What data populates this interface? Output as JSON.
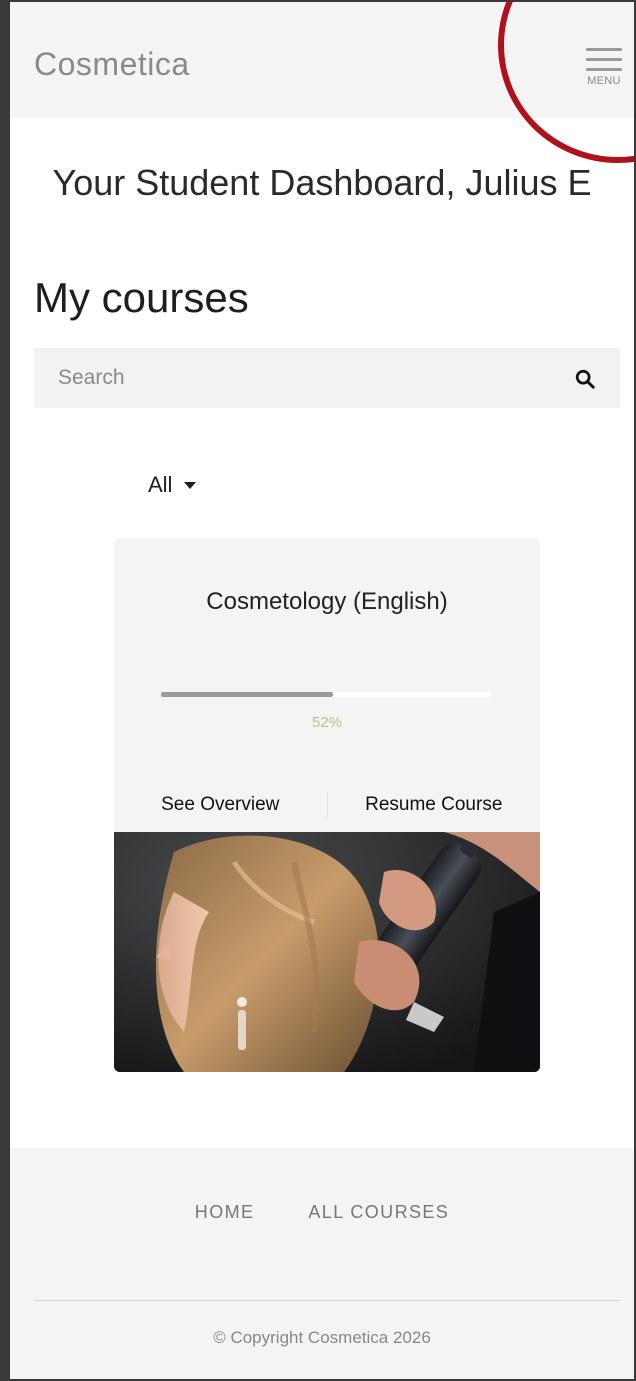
{
  "header": {
    "brand": "Cosmetica",
    "menu_label": "MENU"
  },
  "dashboard": {
    "title": "Your Student Dashboard, Julius E"
  },
  "courses": {
    "heading": "My courses",
    "search": {
      "placeholder": "Search",
      "value": ""
    },
    "filter": {
      "selected": "All"
    },
    "items": [
      {
        "title": "Cosmetology (English)",
        "progress_percent": 52,
        "progress_label": "52%",
        "actions": {
          "overview": "See Overview",
          "resume": "Resume Course"
        },
        "image_icon": "hair-styling-photo"
      }
    ]
  },
  "footer": {
    "nav": [
      "HOME",
      "ALL COURSES"
    ],
    "copyright": "© Copyright Cosmetica 2026"
  },
  "colors": {
    "highlight_circle": "#b0121b",
    "progress_fill": "#9a9a9a",
    "progress_text": "#b8c48a",
    "panel_bg": "#f4f4f4"
  },
  "icons": {
    "menu": "hamburger-menu-icon",
    "search": "search-icon",
    "filter": "caret-down-icon"
  }
}
